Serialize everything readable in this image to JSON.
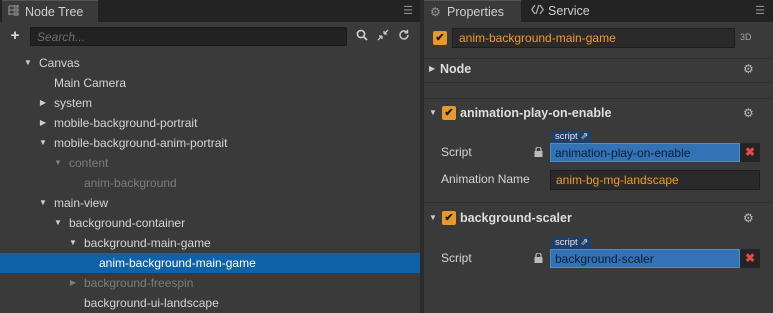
{
  "node_tree": {
    "tab_label": "Node Tree",
    "tab_icon": "tree-icon",
    "search": {
      "placeholder": "Search...",
      "value": ""
    },
    "items": [
      {
        "label": "Canvas",
        "depth": 0,
        "arrow": "expanded",
        "dimmed": false,
        "selected": false
      },
      {
        "label": "Main Camera",
        "depth": 1,
        "arrow": "none",
        "dimmed": false,
        "selected": false
      },
      {
        "label": "system",
        "depth": 1,
        "arrow": "collapsed",
        "dimmed": false,
        "selected": false
      },
      {
        "label": "mobile-background-portrait",
        "depth": 1,
        "arrow": "collapsed",
        "dimmed": false,
        "selected": false
      },
      {
        "label": "mobile-background-anim-portrait",
        "depth": 1,
        "arrow": "expanded",
        "dimmed": false,
        "selected": false
      },
      {
        "label": "content",
        "depth": 2,
        "arrow": "expanded",
        "dimmed": true,
        "selected": false
      },
      {
        "label": "anim-background",
        "depth": 3,
        "arrow": "none",
        "dimmed": true,
        "selected": false
      },
      {
        "label": "main-view",
        "depth": 1,
        "arrow": "expanded",
        "dimmed": false,
        "selected": false
      },
      {
        "label": "background-container",
        "depth": 2,
        "arrow": "expanded",
        "dimmed": false,
        "selected": false
      },
      {
        "label": "background-main-game",
        "depth": 3,
        "arrow": "expanded",
        "dimmed": false,
        "selected": false
      },
      {
        "label": "anim-background-main-game",
        "depth": 4,
        "arrow": "none",
        "dimmed": false,
        "selected": true
      },
      {
        "label": "background-freespin",
        "depth": 3,
        "arrow": "collapsed",
        "dimmed": true,
        "selected": false
      },
      {
        "label": "background-ui-landscape",
        "depth": 3,
        "arrow": "none",
        "dimmed": false,
        "selected": false
      }
    ]
  },
  "properties": {
    "tab_label": "Properties",
    "service_tab_label": "Service",
    "node_name": "anim-background-main-game",
    "node_enabled": true,
    "badge_3d": "3D",
    "node_section_label": "Node",
    "components": [
      {
        "title": "animation-play-on-enable",
        "enabled": true,
        "script_tag": "script",
        "script_label": "Script",
        "script_value": "animation-play-on-enable",
        "extra_label": "Animation Name",
        "extra_value": "anim-bg-mg-landscape"
      },
      {
        "title": "background-scaler",
        "enabled": true,
        "script_tag": "script",
        "script_label": "Script",
        "script_value": "background-scaler"
      }
    ]
  },
  "colors": {
    "accent_orange": "#f39a2b",
    "selection_blue": "#0f61a8",
    "script_field_blue": "#3272b5",
    "remove_red": "#e04b4b"
  }
}
